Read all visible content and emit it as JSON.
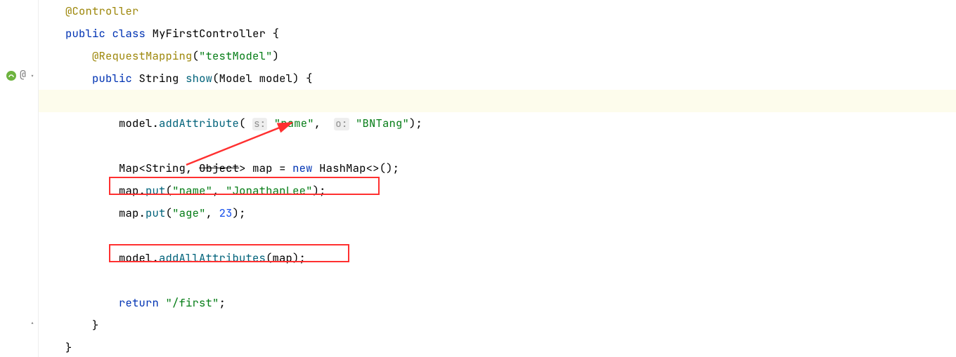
{
  "gutter": {
    "atSymbol": "@"
  },
  "code": {
    "l1_ann": "@Controller",
    "l2_kw1": "public",
    "l2_kw2": "class",
    "l2_cls": "MyFirstController",
    "l2_brace": " {",
    "l3_ann": "@RequestMapping",
    "l3_paren": "(",
    "l3_str": "\"testModel\"",
    "l3_close": ")",
    "l4_kw": "public",
    "l4_ret": "String",
    "l4_name": "show",
    "l4_paren": "(",
    "l4_ptype": "Model",
    "l4_pname": " model",
    "l4_close": ") {",
    "l6_obj": "model.",
    "l6_m": "addAttribute",
    "l6_open": "( ",
    "l6_h1": "s:",
    "l6_s1": " \"name\"",
    "l6_comma": ",  ",
    "l6_h2": "o:",
    "l6_s2": " \"BNTang\"",
    "l6_end": ");",
    "l8_a": "Map<",
    "l8_b": "String",
    "l8_c": ", ",
    "l8_obj": "Object",
    "l8_d": "> map = ",
    "l8_new": "new",
    "l8_e": " HashMap<>();",
    "l9_a": "map.",
    "l9_m": "put",
    "l9_open": "(",
    "l9_s1": "\"name\"",
    "l9_comma": ", ",
    "l9_s2": "\"JonathanLee\"",
    "l9_end": ");",
    "l10_a": "map.",
    "l10_m": "put",
    "l10_open": "(",
    "l10_s1": "\"age\"",
    "l10_comma": ", ",
    "l10_n": "23",
    "l10_end": ");",
    "l12_a": "model.",
    "l12_m": "addAllAttributes",
    "l12_b": "(map);",
    "l14_kw": "return",
    "l14_sp": " ",
    "l14_s": "\"/first\"",
    "l14_end": ";",
    "l15": "}",
    "l16": "}"
  }
}
